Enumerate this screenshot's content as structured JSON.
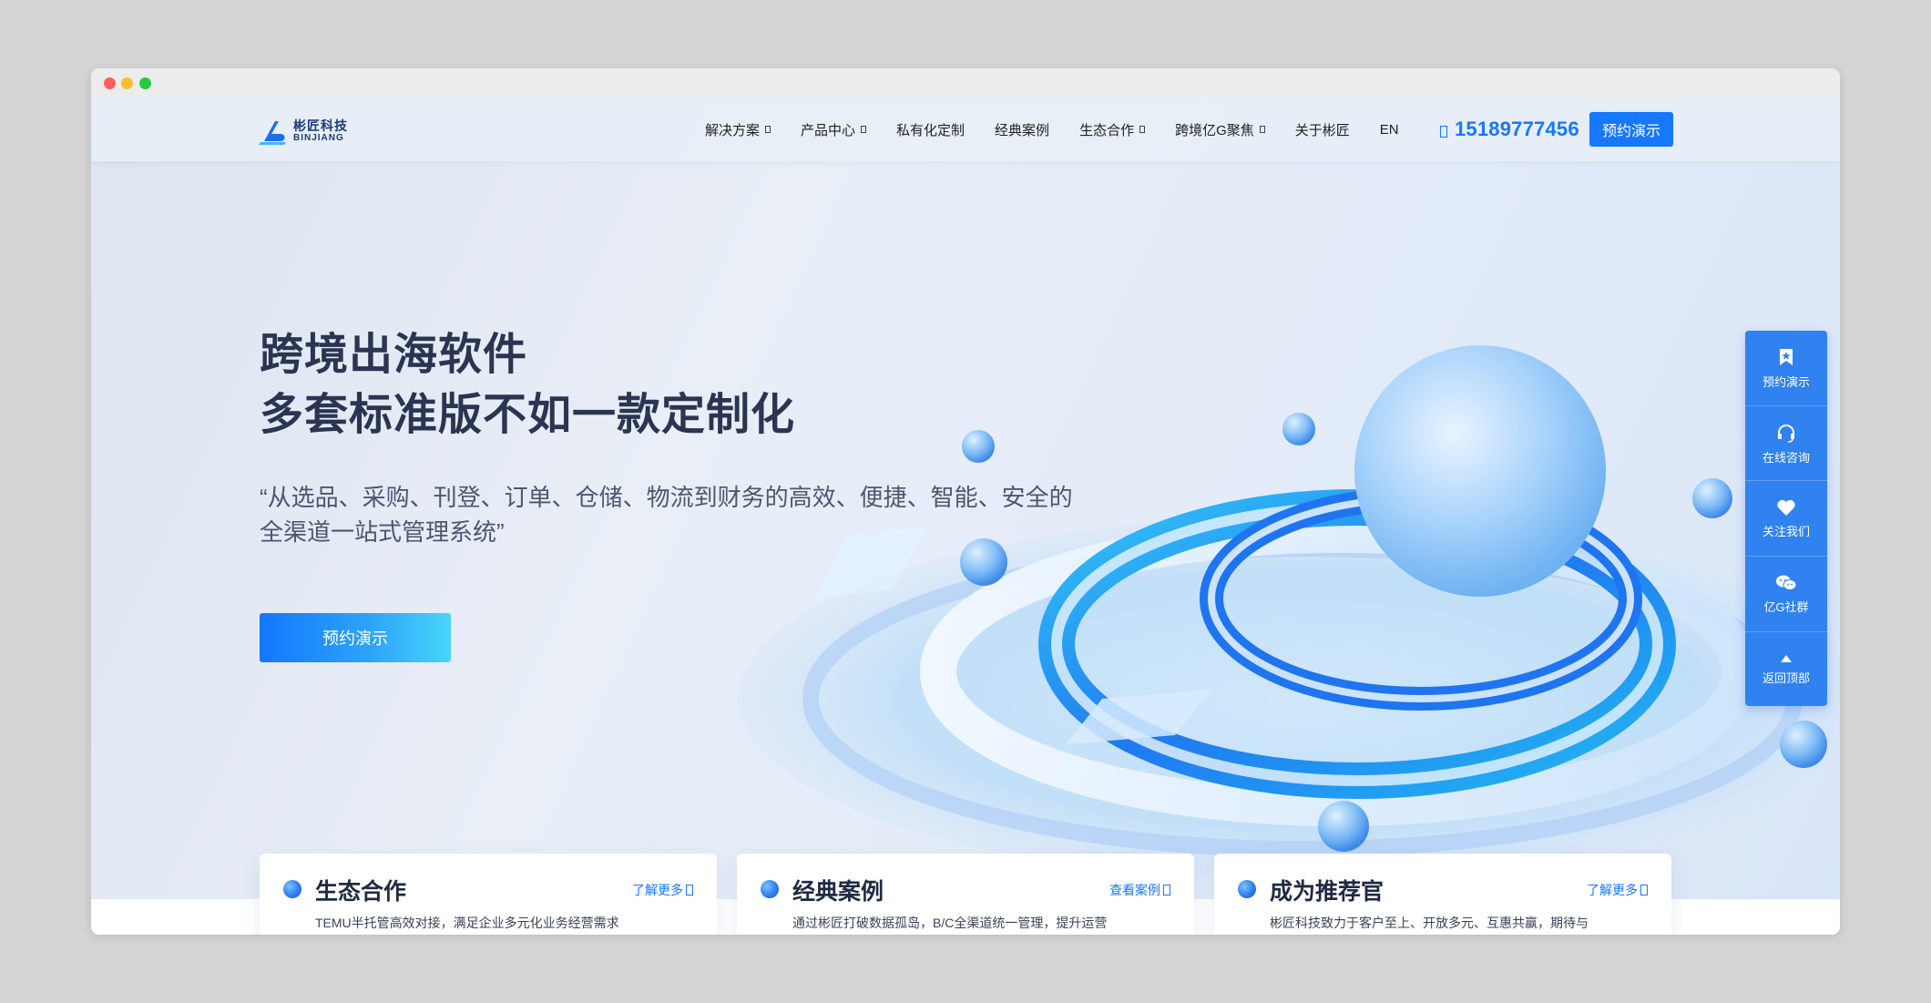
{
  "header": {
    "logo_cn": "彬匠科技",
    "logo_en": "BINJIANG",
    "nav": [
      {
        "label": "解决方案",
        "has_dropdown": true
      },
      {
        "label": "产品中心",
        "has_dropdown": true
      },
      {
        "label": "私有化定制",
        "has_dropdown": false
      },
      {
        "label": "经典案例",
        "has_dropdown": false
      },
      {
        "label": "生态合作",
        "has_dropdown": true
      },
      {
        "label": "跨境亿G聚焦",
        "has_dropdown": true
      },
      {
        "label": "关于彬匠",
        "has_dropdown": false
      },
      {
        "label": "EN",
        "has_dropdown": false
      }
    ],
    "phone": "15189777456",
    "demo_button": "预约演示"
  },
  "hero": {
    "title_line1": "跨境出海软件",
    "title_line2": "多套标准版不如一款定制化",
    "subtitle_line1": "“从选品、采购、刊登、订单、仓储、物流到财务的高效、便捷、智能、安全的",
    "subtitle_line2": "全渠道一站式管理系统”",
    "cta": "预约演示"
  },
  "sidebar": [
    {
      "label": "预约演示",
      "icon": "bookmark-star-icon"
    },
    {
      "label": "在线咨询",
      "icon": "headset-icon"
    },
    {
      "label": "关注我们",
      "icon": "heart-icon"
    },
    {
      "label": "亿G社群",
      "icon": "wechat-icon"
    },
    {
      "label": "返回顶部",
      "icon": "arrow-up-icon"
    }
  ],
  "cards": [
    {
      "title": "生态合作",
      "link": "了解更多",
      "desc": "TEMU半托管高效对接，满足企业多元化业务经营需求"
    },
    {
      "title": "经典案例",
      "link": "查看案例",
      "desc": "通过彬匠打破数据孤岛，B/C全渠道统一管理，提升运营"
    },
    {
      "title": "成为推荐官",
      "link": "了解更多",
      "desc": "彬匠科技致力于客户至上、开放多元、互惠共赢，期待与"
    }
  ],
  "colors": {
    "accent": "#1677ff",
    "title": "#2b3552",
    "sidebar": "#2f82f0"
  }
}
